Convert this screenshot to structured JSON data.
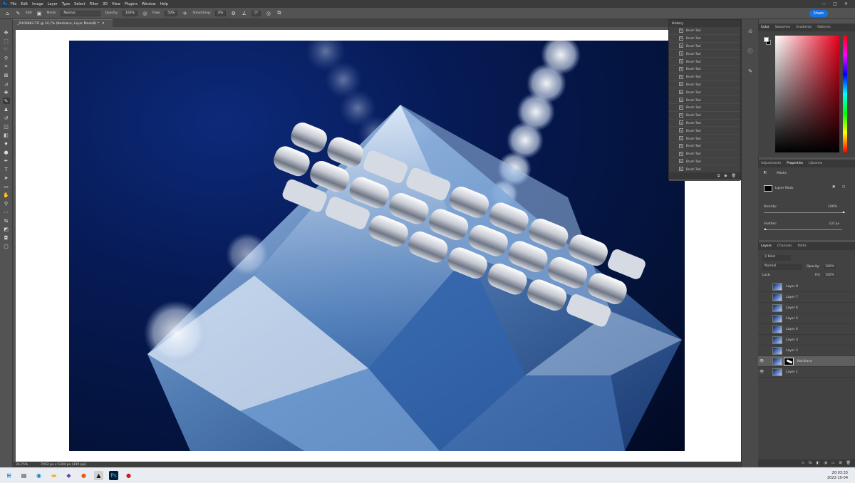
{
  "menubar": {
    "app_icon": "Ps",
    "items": [
      "File",
      "Edit",
      "Image",
      "Layer",
      "Type",
      "Select",
      "Filter",
      "3D",
      "View",
      "Plugins",
      "Window",
      "Help"
    ],
    "window_controls": [
      "—",
      "□",
      "✕"
    ]
  },
  "options": {
    "brush_size": "400",
    "mode_label": "Mode:",
    "mode_value": "Normal",
    "opacity_label": "Opacity:",
    "opacity_value": "100%",
    "flow_label": "Flow:",
    "flow_value": "50%",
    "smoothing_label": "Smoothing:",
    "smoothing_value": "0%",
    "angle_value": "0°",
    "share_label": "Share"
  },
  "document": {
    "tab_title": "_PHO9882.TIF @ 34,7% (Necklace, Layer Mask/8) *",
    "zoom": "34,75%",
    "doc_info": "7952 px x 5304 px (300 ppi)"
  },
  "history": {
    "title": "History",
    "items": [
      "Brush Tool",
      "Brush Tool",
      "Brush Tool",
      "Brush Tool",
      "Brush Tool",
      "Brush Tool",
      "Brush Tool",
      "Brush Tool",
      "Brush Tool",
      "Brush Tool",
      "Brush Tool",
      "Brush Tool",
      "Brush Tool",
      "Brush Tool",
      "Brush Tool",
      "Brush Tool",
      "Brush Tool",
      "Brush Tool",
      "Brush Tool",
      "Brush Tool"
    ]
  },
  "color_panel": {
    "tabs": [
      "Color",
      "Swatches",
      "Gradients",
      "Patterns"
    ],
    "foreground": "#ffffff",
    "background": "#000000"
  },
  "properties": {
    "tabs": [
      "Adjustments",
      "Properties",
      "Libraries"
    ],
    "section": "Masks",
    "mask_label": "Layer Mask",
    "density_label": "Density:",
    "density_value": "100%",
    "feather_label": "Feather:",
    "feather_value": "0,0 px"
  },
  "layers": {
    "tabs": [
      "Layers",
      "Channels",
      "Paths"
    ],
    "filter_label": "Kind",
    "blend_mode": "Normal",
    "opacity_label": "Opacity:",
    "opacity_value": "100%",
    "lock_label": "Lock:",
    "fill_label": "Fill:",
    "fill_value": "100%",
    "rows": [
      {
        "name": "Layer 8",
        "visible": false,
        "selected": false,
        "mask": false
      },
      {
        "name": "Layer 7",
        "visible": false,
        "selected": false,
        "mask": false
      },
      {
        "name": "Layer 6",
        "visible": false,
        "selected": false,
        "mask": false
      },
      {
        "name": "Layer 5",
        "visible": false,
        "selected": false,
        "mask": false
      },
      {
        "name": "Layer 4",
        "visible": false,
        "selected": false,
        "mask": false
      },
      {
        "name": "Layer 3",
        "visible": false,
        "selected": false,
        "mask": false
      },
      {
        "name": "Layer 2",
        "visible": false,
        "selected": false,
        "mask": false
      },
      {
        "name": "Necklace",
        "visible": true,
        "selected": true,
        "mask": true
      },
      {
        "name": "Layer 1",
        "visible": true,
        "selected": false,
        "mask": false
      }
    ]
  },
  "taskbar": {
    "time": "20:03:33",
    "date": "2022-10-04"
  }
}
